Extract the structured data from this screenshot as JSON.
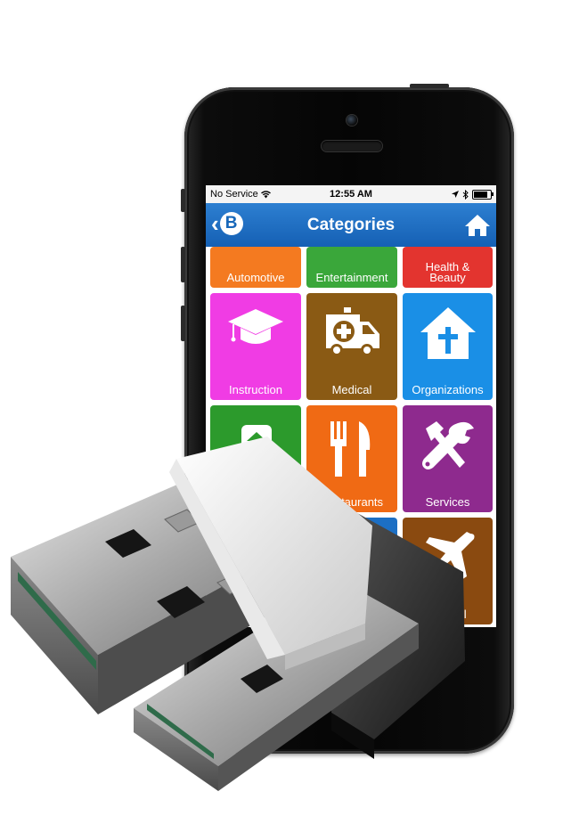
{
  "status_bar": {
    "carrier": "No Service",
    "time": "12:55 AM"
  },
  "nav": {
    "title": "Categories",
    "logo_letter": "B"
  },
  "categories": [
    {
      "label": "Automotive",
      "color": "#f47a20"
    },
    {
      "label": "Entertainment",
      "color": "#3aa73a"
    },
    {
      "label": "Health & Beauty",
      "color": "#e3342f"
    },
    {
      "label": "Instruction",
      "color": "#f03ce4",
      "icon": "graduation-cap-icon"
    },
    {
      "label": "Medical",
      "color": "#8a5a14",
      "icon": "ambulance-icon"
    },
    {
      "label": "Organizations",
      "color": "#1a8fe6",
      "icon": "church-icon"
    },
    {
      "label": "",
      "color": "#2c9a2c",
      "icon": "house-icon"
    },
    {
      "label": "Restaurants",
      "color": "#f06a14",
      "icon": "fork-knife-icon"
    },
    {
      "label": "Services",
      "color": "#8e2a8e",
      "icon": "tools-icon"
    },
    {
      "label": "",
      "color": "#1c6fc4"
    },
    {
      "label": "Travel",
      "color": "#8a4a10",
      "icon": "airplane-icon"
    }
  ],
  "labels": {
    "health_line1": "Health &",
    "health_line2": "Beauty",
    "travel_partial": "ravel",
    "restaurants_partial": "Restaurants"
  }
}
